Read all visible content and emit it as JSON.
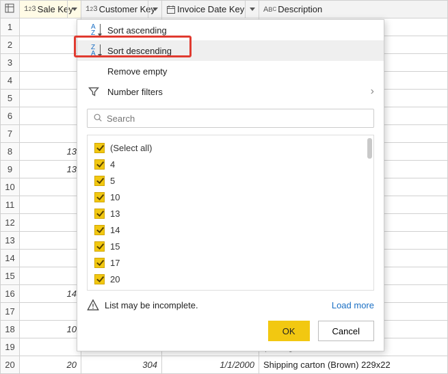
{
  "columns": {
    "sale_key": "Sale Key",
    "customer_key": "Customer Key",
    "invoice_date_key": "Invoice Date Key",
    "description": "Description"
  },
  "menu": {
    "sort_asc": "Sort ascending",
    "sort_desc": "Sort descending",
    "remove_empty": "Remove empty",
    "number_filters": "Number filters"
  },
  "search": {
    "placeholder": "Search"
  },
  "filter_values": {
    "select_all": "(Select all)",
    "items": [
      "4",
      "5",
      "10",
      "13",
      "14",
      "15",
      "17",
      "20"
    ]
  },
  "footer": {
    "incomplete": "List may be incomplete.",
    "load_more": "Load more",
    "ok": "OK",
    "cancel": "Cancel"
  },
  "rows": [
    {
      "n": 1,
      "sale": "",
      "cust": "",
      "inv": "",
      "desc": "ng - inheritanc"
    },
    {
      "n": 2,
      "sale": "",
      "cust": "",
      "inv": "",
      "desc": "White) 400L"
    },
    {
      "n": 3,
      "sale": "",
      "cust": "",
      "inv": "",
      "desc": "e - pizza slice"
    },
    {
      "n": 4,
      "sale": "",
      "cust": "",
      "inv": "",
      "desc": "lass with care"
    },
    {
      "n": 5,
      "sale": "",
      "cust": "",
      "inv": "",
      "desc": " (Gray) S"
    },
    {
      "n": 6,
      "sale": "",
      "cust": "",
      "inv": "",
      "desc": "Pink) M"
    },
    {
      "n": 7,
      "sale": "",
      "cust": "",
      "inv": "",
      "desc": "(ML tag t-shir"
    },
    {
      "n": 8,
      "sale": "13",
      "cust": "",
      "inv": "",
      "desc": "cket (Blue) S"
    },
    {
      "n": 9,
      "sale": "13",
      "cust": "",
      "inv": "",
      "desc": "vare: part of th"
    },
    {
      "n": 10,
      "sale": "",
      "cust": "",
      "inv": "",
      "desc": "cket (Blue) M"
    },
    {
      "n": 11,
      "sale": "",
      "cust": "",
      "inv": "",
      "desc": "ig - (hip, hip, a"
    },
    {
      "n": 12,
      "sale": "",
      "cust": "",
      "inv": "",
      "desc": "(ML tag t-shir"
    },
    {
      "n": 13,
      "sale": "",
      "cust": "",
      "inv": "",
      "desc": "netal insert bl"
    },
    {
      "n": 14,
      "sale": "",
      "cust": "",
      "inv": "",
      "desc": "blades 18mm"
    },
    {
      "n": 15,
      "sale": "",
      "cust": "",
      "inv": "",
      "desc": "olue 5mm nib"
    },
    {
      "n": 16,
      "sale": "14",
      "cust": "",
      "inv": "",
      "desc": "cket (Blue) S"
    },
    {
      "n": 17,
      "sale": "",
      "cust": "",
      "inv": "",
      "desc": "e 48mmx75m"
    },
    {
      "n": 18,
      "sale": "10",
      "cust": "",
      "inv": "",
      "desc": "owered slippe"
    },
    {
      "n": 19,
      "sale": "",
      "cust": "",
      "inv": "",
      "desc": "(ML tag t-shir"
    },
    {
      "n": 20,
      "sale": "20",
      "cust": "304",
      "inv": "1/1/2000",
      "desc": "Shipping carton (Brown) 229x22"
    }
  ]
}
